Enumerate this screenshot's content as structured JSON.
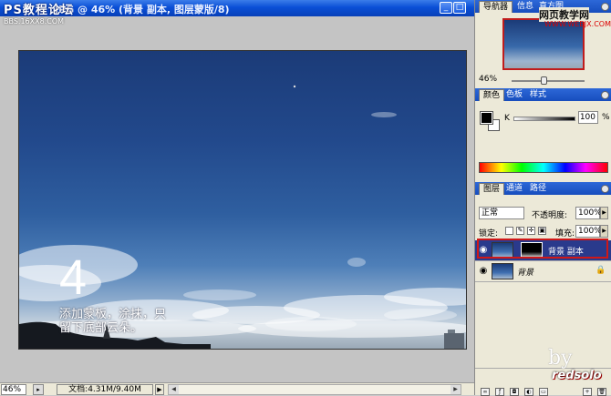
{
  "document": {
    "title": "JPG @ 46% (背景 副本, 图层蒙版/8)",
    "watermark": "PS教程论坛",
    "watermark_sub": "BBS.16XX8.COM",
    "canvas": {
      "big_number": "4",
      "caption_line1": "添加蒙板，涂抹，只",
      "caption_line2": "留下底部云朵。"
    },
    "status": {
      "zoom": "46%",
      "doc_size": "文档:4.31M/9.40M"
    }
  },
  "panels": {
    "navigator": {
      "tabs": [
        "导航器",
        "信息",
        "直方图"
      ],
      "zoom": "46%",
      "zoom_fraction": 0.46,
      "site_watermark": "网页教学网",
      "site_url": "WWW.WEBJX.COM"
    },
    "color": {
      "tabs": [
        "颜色",
        "色板",
        "样式"
      ],
      "channel_label": "K",
      "channel_value": "100",
      "unit": "%"
    },
    "layers": {
      "tabs": [
        "图层",
        "通道",
        "路径"
      ],
      "blend_mode": "正常",
      "opacity_label": "不透明度:",
      "opacity_value": "100%",
      "lock_label": "锁定:",
      "fill_label": "填充:",
      "fill_value": "100%",
      "items": [
        {
          "name": "背景 副本",
          "selected": true,
          "has_mask": true
        },
        {
          "name": "背景",
          "selected": false,
          "locked": true
        }
      ]
    },
    "signature": "redsolo",
    "signature_by": "by"
  },
  "colors": {
    "title_blue": "#0a4fd6",
    "selected_layer": "#2a3a8c",
    "highlight_red": "#d01818"
  }
}
